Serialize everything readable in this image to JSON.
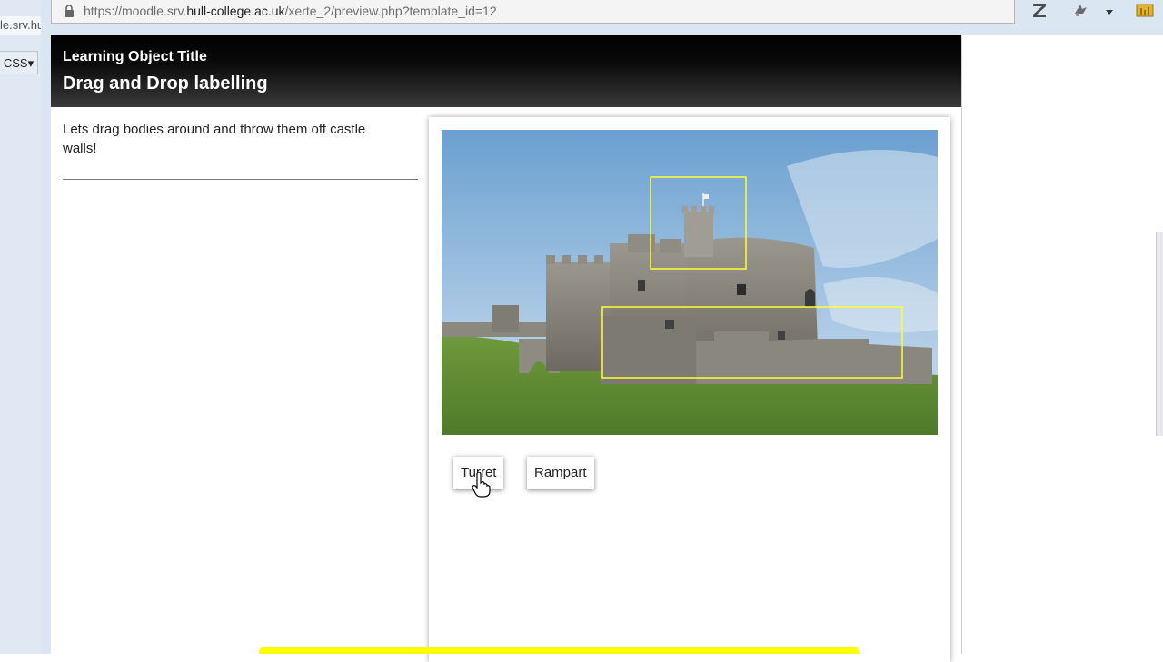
{
  "background_window": {
    "tab_text": "le.srv.hull",
    "css_button": "CSS▾"
  },
  "browser": {
    "url_prefix": "https://moodle.srv.",
    "url_domain": "hull-college.ac.uk",
    "url_path": "/xerte_2/preview.php?template_id=12",
    "toolbar_icons": [
      "zotero-icon",
      "extension-icon",
      "dropdown-arrow-icon",
      "folder-icon"
    ]
  },
  "learning_object": {
    "title": "Learning Object Title",
    "page_title": "Drag and Drop labelling",
    "intro_text": "Lets drag bodies around and throw them off castle walls!"
  },
  "activity": {
    "labels": [
      {
        "text": "Turret"
      },
      {
        "text": "Rampart"
      }
    ],
    "hotspot_color": "#ffff33"
  },
  "colors": {
    "header_bg": "#000000",
    "progress_bar": "#ffff00"
  }
}
